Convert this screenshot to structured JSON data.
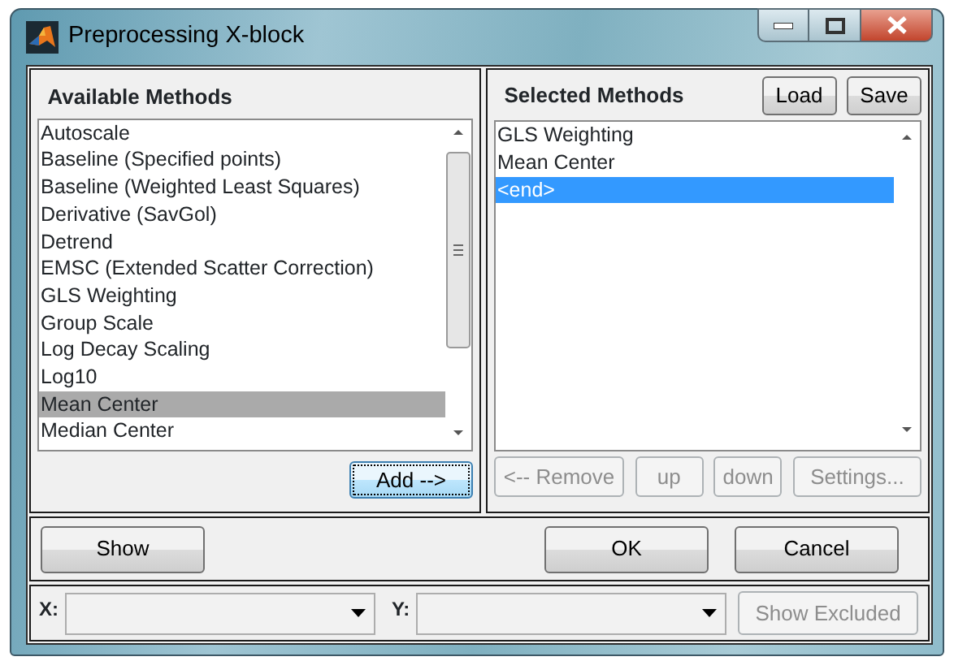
{
  "window": {
    "title": "Preprocessing X-block"
  },
  "available": {
    "title": "Available Methods",
    "items": [
      {
        "label": "Autoscale",
        "selected": false
      },
      {
        "label": "Baseline (Specified points)",
        "selected": false
      },
      {
        "label": "Baseline (Weighted Least Squares)",
        "selected": false
      },
      {
        "label": "Derivative (SavGol)",
        "selected": false
      },
      {
        "label": "Detrend",
        "selected": false
      },
      {
        "label": "EMSC (Extended Scatter Correction)",
        "selected": false
      },
      {
        "label": "GLS Weighting",
        "selected": false
      },
      {
        "label": "Group Scale",
        "selected": false
      },
      {
        "label": "Log Decay Scaling",
        "selected": false
      },
      {
        "label": "Log10",
        "selected": false
      },
      {
        "label": "Mean Center",
        "selected": true
      },
      {
        "label": "Median Center",
        "selected": false
      }
    ],
    "add_button": {
      "label": "Add -->",
      "focused": true
    }
  },
  "selected_methods": {
    "title": "Selected Methods",
    "header_buttons": [
      {
        "label": "Load",
        "disabled": false
      },
      {
        "label": "Save",
        "disabled": false
      }
    ],
    "items": [
      {
        "label": "GLS Weighting",
        "selected": false
      },
      {
        "label": "Mean Center",
        "selected": false
      },
      {
        "label": "<end>",
        "selected": true
      }
    ],
    "buttons": [
      {
        "label": "<-- Remove",
        "disabled": true
      },
      {
        "label": "up",
        "disabled": true
      },
      {
        "label": "down",
        "disabled": true
      },
      {
        "label": "Settings...",
        "disabled": true
      }
    ]
  },
  "actions": [
    {
      "label": "Show"
    },
    {
      "label": "OK"
    },
    {
      "label": "Cancel"
    }
  ],
  "plot": {
    "x_label": "X:",
    "y_label": "Y:",
    "show_excluded": {
      "label": "Show Excluded",
      "disabled": true
    }
  }
}
